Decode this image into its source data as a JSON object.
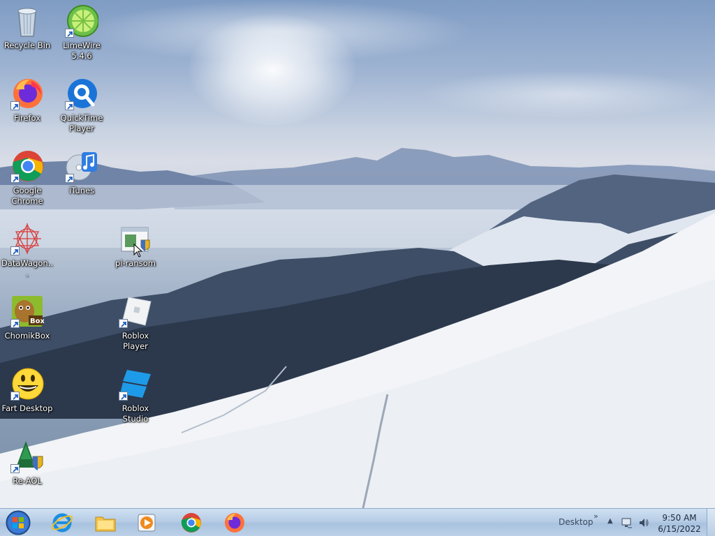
{
  "desktop": {
    "icons": [
      {
        "label": "Recycle Bin",
        "icon": "recycle-bin-icon",
        "shortcut": false
      },
      {
        "label": "LimeWire 5.4.6",
        "icon": "limewire-icon",
        "shortcut": true
      },
      {
        "label": "Firefox",
        "icon": "firefox-icon",
        "shortcut": true
      },
      {
        "label": "QuickTime Player",
        "icon": "quicktime-icon",
        "shortcut": true
      },
      {
        "label": "Google Chrome",
        "icon": "chrome-icon",
        "shortcut": true
      },
      {
        "label": "iTunes",
        "icon": "itunes-icon",
        "shortcut": true
      },
      {
        "label": "DataWagon...",
        "icon": "datawagon-icon",
        "shortcut": true
      },
      {
        "label": "pi-ransom",
        "icon": "pi-ransom-icon",
        "shortcut": false
      },
      {
        "label": "ChomikBox",
        "icon": "chomikbox-icon",
        "shortcut": true
      },
      {
        "label": "Roblox Player",
        "icon": "roblox-player-icon",
        "shortcut": true
      },
      {
        "label": "Fart Desktop",
        "icon": "fart-desktop-icon",
        "shortcut": true
      },
      {
        "label": "Roblox Studio",
        "icon": "roblox-studio-icon",
        "shortcut": true
      },
      {
        "label": "Re-AOL",
        "icon": "re-aol-icon",
        "shortcut": true
      }
    ]
  },
  "taskbar": {
    "start": {
      "icon": "windows-start-icon"
    },
    "pinned": [
      {
        "icon": "internet-explorer-icon"
      },
      {
        "icon": "file-explorer-icon"
      },
      {
        "icon": "media-player-icon"
      },
      {
        "icon": "chrome-icon"
      },
      {
        "icon": "firefox-icon"
      }
    ],
    "tray": {
      "desktop_label": "Desktop",
      "chevron": "»",
      "time": "9:50 AM",
      "date": "6/15/2022"
    }
  },
  "colors": {
    "taskbar": "#b7cde6",
    "label_text": "#ffffff"
  }
}
